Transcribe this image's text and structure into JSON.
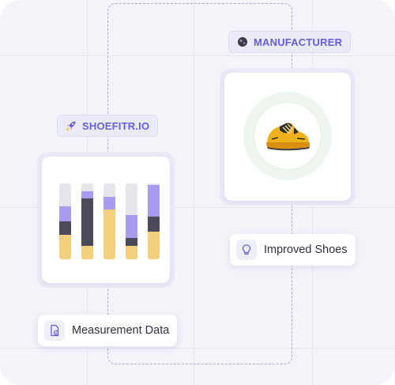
{
  "tags": {
    "manufacturer": "MANUFACTURER",
    "shoefitr": "SHOEFITR.IO"
  },
  "pills": {
    "improved": "Improved Shoes",
    "measurement": "Measurement Data"
  },
  "icons": {
    "manufacturer_tag": "globe-icon",
    "shoefitr_tag": "rocket-icon",
    "improved_pill": "lightbulb-icon",
    "measurement_pill": "document-check-icon",
    "product": "sneaker-icon"
  },
  "colors": {
    "accent": "#6b5be0",
    "dash": "#a9a9e6",
    "bar_top": "#a89cf0",
    "bar_mid": "#4a4a58",
    "bar_bottom": "#f4cf7d",
    "bar_track": "#e5e5ec"
  },
  "bar_chart": {
    "bars": [
      {
        "track": 0.3,
        "top": 0.2,
        "mid": 0.18,
        "bottom": 0.32
      },
      {
        "track": 0.1,
        "top": 0.1,
        "mid": 0.62,
        "bottom": 0.18
      },
      {
        "track": 0.18,
        "top": 0.16,
        "mid": 0.0,
        "bottom": 0.66
      },
      {
        "track": 0.42,
        "top": 0.3,
        "mid": 0.1,
        "bottom": 0.18
      },
      {
        "track": 0.02,
        "top": 0.42,
        "mid": 0.2,
        "bottom": 0.36
      }
    ]
  }
}
